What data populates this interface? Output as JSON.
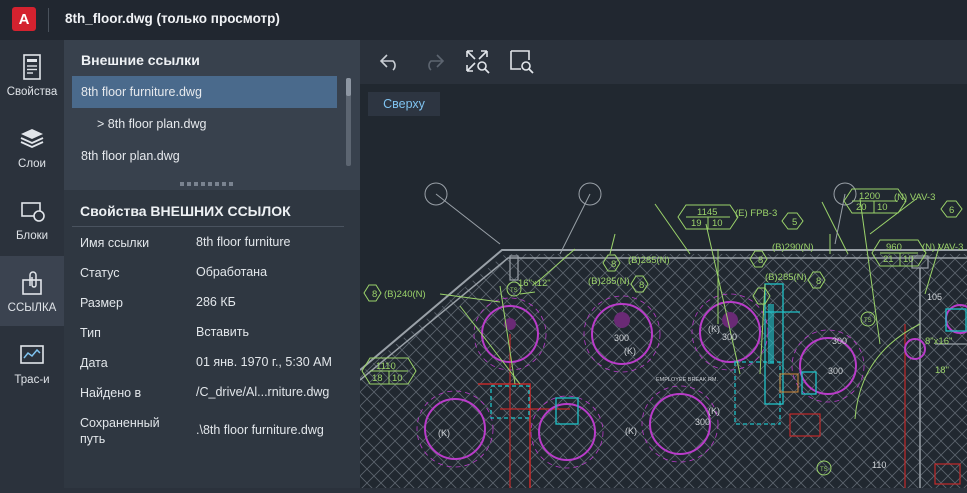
{
  "window": {
    "app_icon_letter": "A",
    "title": "8th_floor.dwg (только просмотр)"
  },
  "toolrail": {
    "items": [
      {
        "label": "Свойства",
        "icon": "properties-icon"
      },
      {
        "label": "Слои",
        "icon": "layers-icon"
      },
      {
        "label": "Блоки",
        "icon": "blocks-icon"
      },
      {
        "label": "ССЫЛКА",
        "icon": "xref-clip-icon",
        "active": true
      },
      {
        "label": "Трас-и",
        "icon": "trace-icon"
      }
    ]
  },
  "xrefs": {
    "heading": "Внешние ссылки",
    "items": [
      {
        "label": "8th floor furniture.dwg",
        "selected": true
      },
      {
        "label": "> 8th floor plan.dwg",
        "selected": false
      },
      {
        "label": "8th floor plan.dwg",
        "selected": false
      }
    ]
  },
  "properties": {
    "heading": "Свойства ВНЕШНИХ ССЫЛОК",
    "rows": [
      {
        "label": "Имя ссылки",
        "value": "8th floor furniture"
      },
      {
        "label": "Статус",
        "value": "Обработана"
      },
      {
        "label": "Размер",
        "value": "286 КБ"
      },
      {
        "label": "Тип",
        "value": "Вставить"
      },
      {
        "label": "Дата",
        "value": "01 янв. 1970 г., 5:30 AM"
      },
      {
        "label": "Найдено в",
        "value": "/C_drive/Al...rniture.dwg"
      },
      {
        "label": "Сохраненный путь",
        "value": ".\\8th floor furniture.dwg"
      }
    ]
  },
  "canvas": {
    "toolbar": [
      {
        "name": "undo",
        "icon": "undo-icon"
      },
      {
        "name": "redo",
        "icon": "redo-icon"
      },
      {
        "name": "zoom-extents",
        "icon": "zoom-extents-icon"
      },
      {
        "name": "zoom-window",
        "icon": "zoom-window-icon"
      }
    ],
    "view_label": "Сверху",
    "drawing_labels": {
      "t1145": "1145",
      "tE": "(E) FPB-3",
      "t5": "5",
      "t19": "19",
      "t10a": "10",
      "t1200": "1200",
      "tN1": "(N) VAV-3",
      "t6": "6",
      "t20": "20",
      "t10b": "10",
      "t960": "960",
      "tN2": "(N) VAV-3",
      "t21": "21",
      "t10c": "10",
      "tB285": "(B)285(N)",
      "tB290": "(B)290(N)",
      "tB285b": "(B)285(N)",
      "tB285c": "(B)285(N)",
      "t8a": "8",
      "t8b": "8",
      "t8c": "8",
      "t8d": "8",
      "t8e": "8",
      "t16x12": "16\"x12\"",
      "tB240": "(B)240(N)",
      "t1110": "1110",
      "t18": "18",
      "t10d": "10",
      "t300a": "300",
      "t300b": "300",
      "t300c": "300",
      "t300d": "300",
      "t300e": "300",
      "tKa": "(K)",
      "tKb": "(K)",
      "tKc": "(K)",
      "tKd": "(K)",
      "tKe": "(K)",
      "t105": "105",
      "t8x16": "8\"x16\"",
      "t18b": "18\"",
      "t110": "110",
      "tTS1": "TS",
      "tTS2": "TS",
      "tTS3": "TS",
      "temp": "EMPLOYEE BREAK RM."
    }
  },
  "colors": {
    "accent_blue": "#7fc3f0",
    "selection": "#4a6a8c",
    "cad_green": "#9bd36a",
    "cad_magenta": "#b93cc9",
    "cad_red": "#c22a2a",
    "cad_cyan": "#1fc2c8",
    "cad_grey": "#9aa1a8"
  }
}
